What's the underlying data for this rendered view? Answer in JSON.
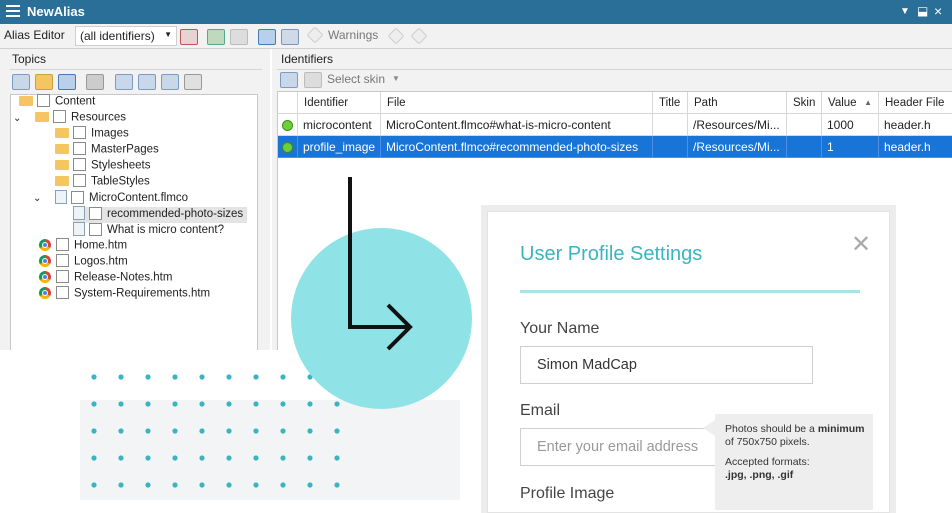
{
  "app": {
    "title": "NewAlias"
  },
  "toolbar": {
    "editor_label": "Alias Editor",
    "filter_value": "(all identifiers)",
    "warnings_label": "Warnings"
  },
  "topics": {
    "title": "Topics",
    "tree": [
      {
        "label": "Content",
        "kind": "folder"
      },
      {
        "label": "Resources",
        "kind": "folder"
      },
      {
        "label": "Images",
        "kind": "folder"
      },
      {
        "label": "MasterPages",
        "kind": "folder"
      },
      {
        "label": "Stylesheets",
        "kind": "folder"
      },
      {
        "label": "TableStyles",
        "kind": "folder"
      },
      {
        "label": "MicroContent.flmco",
        "kind": "file"
      },
      {
        "label": "recommended-photo-sizes",
        "kind": "file"
      },
      {
        "label": "What is micro content?",
        "kind": "file"
      },
      {
        "label": "Home.htm",
        "kind": "web"
      },
      {
        "label": "Logos.htm",
        "kind": "web"
      },
      {
        "label": "Release-Notes.htm",
        "kind": "web"
      },
      {
        "label": "System-Requirements.htm",
        "kind": "web"
      }
    ]
  },
  "identifiers": {
    "title": "Identifiers",
    "select_skin_label": "Select skin",
    "columns": [
      "Identifier",
      "File",
      "Title",
      "Path",
      "Skin",
      "Value",
      "Header File"
    ],
    "rows": [
      {
        "identifier": "microcontent",
        "file": "MicroContent.flmco#what-is-micro-content",
        "title": "",
        "path": "/Resources/Mi...",
        "skin": "",
        "value": "1000",
        "header": "header.h",
        "selected": false
      },
      {
        "identifier": "profile_image",
        "file": "MicroContent.flmco#recommended-photo-sizes",
        "title": "",
        "path": "/Resources/Mi...",
        "skin": "",
        "value": "1",
        "header": "header.h",
        "selected": true
      }
    ]
  },
  "profile_card": {
    "title": "User Profile Settings",
    "name_label": "Your Name",
    "name_value": "Simon MadCap",
    "email_label": "Email",
    "email_placeholder": "Enter your email address",
    "image_label": "Profile Image"
  },
  "tooltip": {
    "line1_pre": "Photos should be a",
    "line1_bold": "minimum",
    "line1_post": "of 750x750 pixels.",
    "line2": "Accepted formats:",
    "line3": ".jpg, .png, .gif"
  },
  "colors": {
    "titlebar": "#2a6f97",
    "selection": "#1874d6",
    "accent": "#3bb4c1",
    "circle": "#8fe2e5"
  }
}
